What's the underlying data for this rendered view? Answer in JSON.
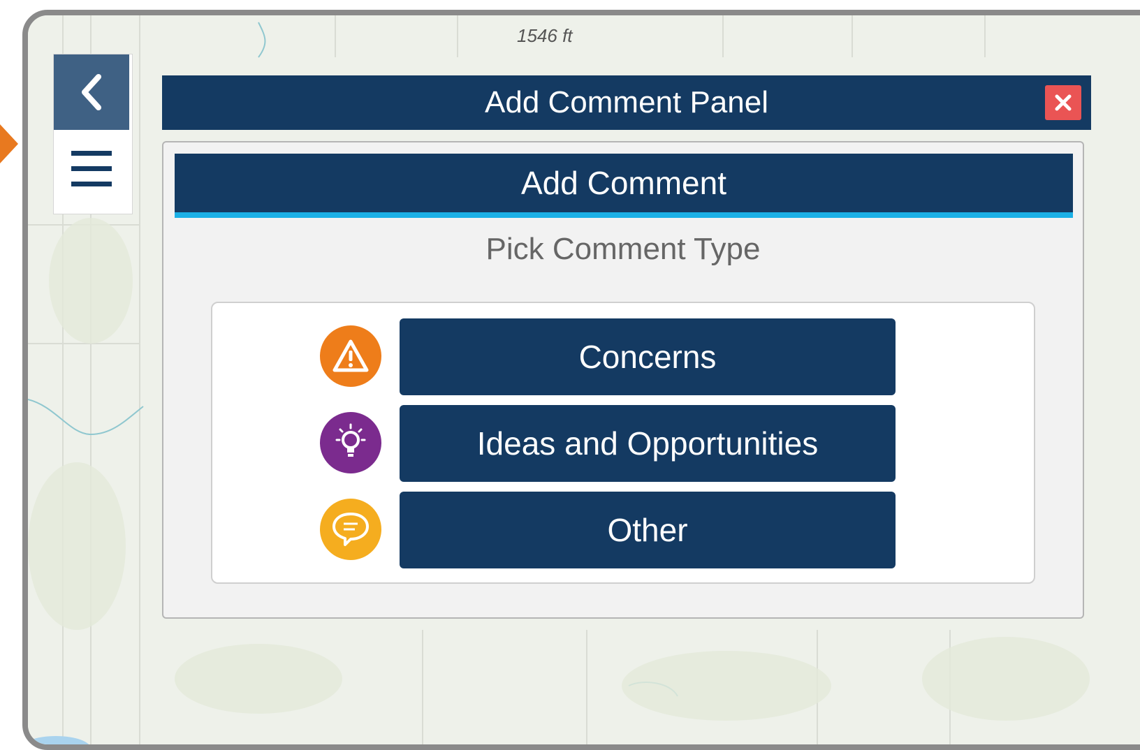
{
  "map": {
    "scale_label": "1546 ft"
  },
  "toolbar": {
    "back_icon": "chevron-left-icon",
    "menu_icon": "hamburger-menu-icon"
  },
  "panel": {
    "title": "Add Comment Panel",
    "close_icon": "close-icon",
    "tab_label": "Add Comment",
    "prompt": "Pick Comment Type",
    "comment_types": [
      {
        "label": "Concerns",
        "icon": "warning-icon",
        "color": "#ee7d1a"
      },
      {
        "label": "Ideas and Opportunities",
        "icon": "lightbulb-icon",
        "color": "#7b2b8e"
      },
      {
        "label": "Other",
        "icon": "speech-bubble-icon",
        "color": "#f5ad1f"
      }
    ]
  },
  "colors": {
    "header_bg": "#143a62",
    "tab_underline": "#1bb0e6",
    "close_bg": "#ea5454",
    "back_button_bg": "#3f6184",
    "pointer": "#e8791f"
  }
}
